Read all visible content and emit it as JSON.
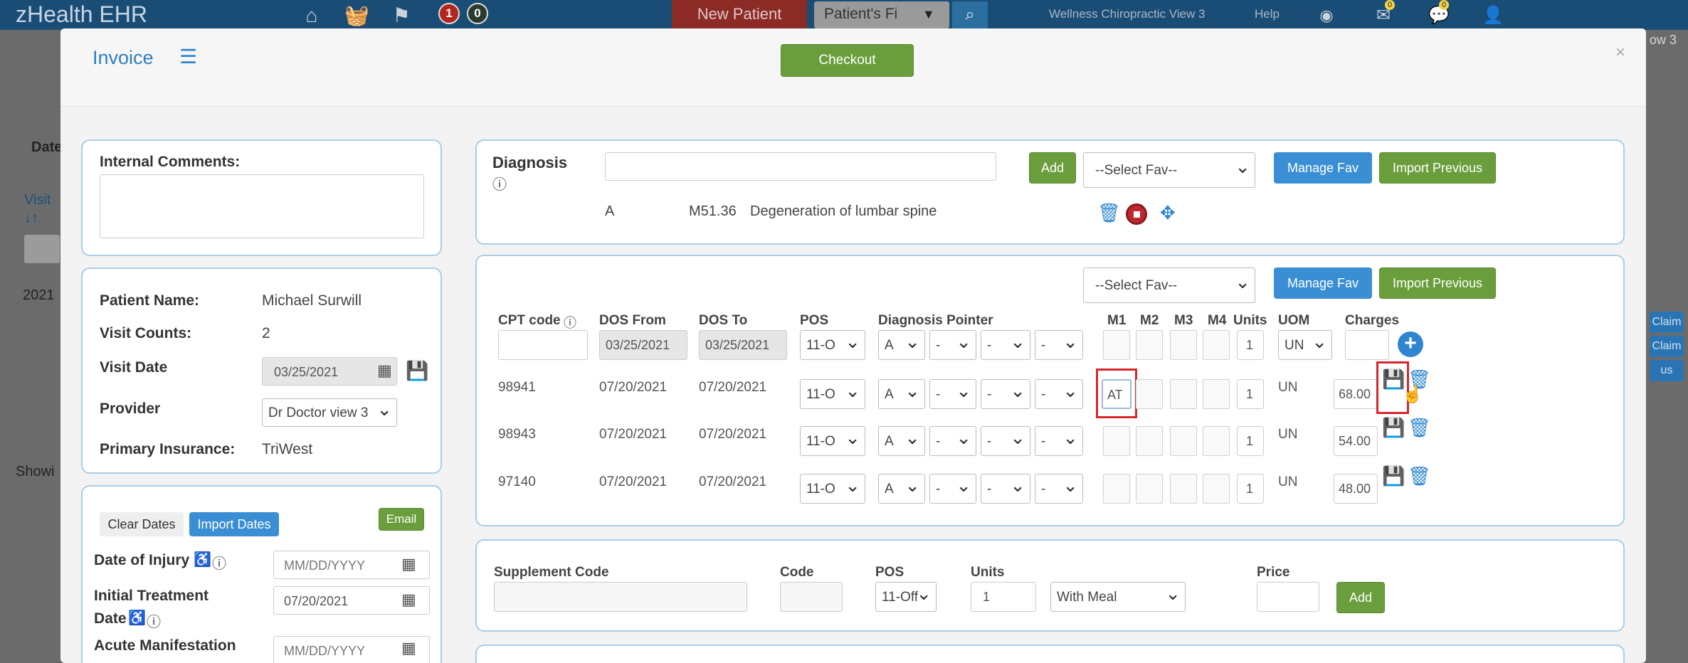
{
  "topbar": {
    "brand": "zHealth EHR",
    "badge_red": "1",
    "badge_dark": "0",
    "new_patient": "New Patient",
    "patient_search_placeholder": "Patient's Fi",
    "location": "Wellness Chiropractic View 3",
    "help": "Help",
    "badge_mail": "0",
    "badge_chat": "0"
  },
  "background": {
    "date_label": "Date",
    "visit_label": "Visit",
    "sort_icon_text": "↓↑",
    "year": "2021",
    "show_text": "Showi",
    "view_dropdown": "ow 3",
    "claim_btn_1": "Claim",
    "claim_btn_2": "Claim",
    "us_btn": "us"
  },
  "modal": {
    "title": "Invoice",
    "checkout": "Checkout",
    "close": "×"
  },
  "left": {
    "internal_comments_label": "Internal Comments:",
    "internal_comments_value": "",
    "patient_name_label": "Patient Name:",
    "patient_name": "Michael Surwill",
    "visit_counts_label": "Visit Counts:",
    "visit_counts": "2",
    "visit_date_label": "Visit Date",
    "visit_date": "03/25/2021",
    "provider_label": "Provider",
    "provider": "Dr Doctor view 3",
    "primary_insurance_label": "Primary Insurance:",
    "primary_insurance": "TriWest",
    "clear_dates": "Clear Dates",
    "import_dates": "Import Dates",
    "email": "Email",
    "date_of_injury_label": "Date of Injury",
    "date_of_injury_placeholder": "MM/DD/YYYY",
    "initial_treatment_label_1": "Initial Treatment",
    "initial_treatment_label_2": "Date",
    "initial_treatment_date": "07/20/2021",
    "acute_label": "Acute Manifestation",
    "acute_placeholder": "MM/DD/YYYY"
  },
  "diagnosis": {
    "label": "Diagnosis",
    "search_value": "",
    "add": "Add",
    "select_fav": "--Select Fav--",
    "manage_fav": "Manage Fav",
    "import_previous": "Import Previous",
    "entries": [
      {
        "letter": "A",
        "code": "M51.36",
        "description": "Degeneration of lumbar spine"
      }
    ]
  },
  "procedures": {
    "select_fav": "--Select Fav--",
    "manage_fav": "Manage Fav",
    "import_previous": "Import Previous",
    "headers": {
      "cpt": "CPT code",
      "dos_from": "DOS From",
      "dos_to": "DOS To",
      "pos": "POS",
      "diagnosis_pointer": "Diagnosis Pointer",
      "m1": "M1",
      "m2": "M2",
      "m3": "M3",
      "m4": "M4",
      "units": "Units",
      "uom": "UOM",
      "charges": "Charges"
    },
    "new_row": {
      "cpt": "",
      "dos_from": "03/25/2021",
      "dos_to": "03/25/2021",
      "pos": "11-O",
      "ptr1": "A",
      "ptr2": "-",
      "ptr3": "-",
      "ptr4": "-",
      "units": "1",
      "uom": "UN"
    },
    "rows": [
      {
        "cpt": "98941",
        "dos_from": "07/20/2021",
        "dos_to": "07/20/2021",
        "pos": "11-O",
        "ptr1": "A",
        "ptr2": "-",
        "ptr3": "-",
        "ptr4": "-",
        "m1": "AT",
        "units": "1",
        "uom": "UN",
        "charges": "68.00"
      },
      {
        "cpt": "98943",
        "dos_from": "07/20/2021",
        "dos_to": "07/20/2021",
        "pos": "11-O",
        "ptr1": "A",
        "ptr2": "-",
        "ptr3": "-",
        "ptr4": "-",
        "m1": "",
        "units": "1",
        "uom": "UN",
        "charges": "54.00"
      },
      {
        "cpt": "97140",
        "dos_from": "07/20/2021",
        "dos_to": "07/20/2021",
        "pos": "11-O",
        "ptr1": "A",
        "ptr2": "-",
        "ptr3": "-",
        "ptr4": "-",
        "m1": "",
        "units": "1",
        "uom": "UN",
        "charges": "48.00"
      }
    ]
  },
  "supplement": {
    "supplement_code_label": "Supplement Code",
    "code_label": "Code",
    "pos_label": "POS",
    "units_label": "Units",
    "price_label": "Price",
    "pos": "11-Off",
    "units": "1",
    "meal": "With Meal",
    "add": "Add"
  },
  "colors": {
    "accent_blue": "#3a8fd4",
    "green": "#6a9e3c",
    "highlight_red": "#d9262b",
    "topbar": "#1a4d76"
  }
}
